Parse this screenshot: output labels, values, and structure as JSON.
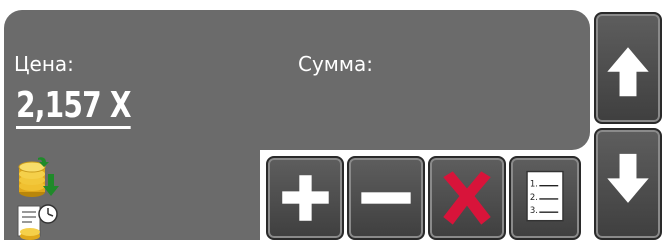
{
  "panel": {
    "price_label": "Цена:",
    "sum_label": "Сумма:",
    "price_value": "2,157 X"
  },
  "icons": {
    "coins": "coins-transfer-icon",
    "report": "report-clock-icon"
  },
  "buttons": {
    "plus": "plus-icon",
    "minus": "minus-icon",
    "delete": "delete-x-icon",
    "list": "numbered-list-icon",
    "up": "arrow-up-icon",
    "down": "arrow-down-icon"
  },
  "list_icon_numbers": [
    "1.",
    "2.",
    "3."
  ],
  "colors": {
    "panel": "#6b6b6b",
    "delete_red": "#d8143a",
    "text": "#ffffff"
  }
}
